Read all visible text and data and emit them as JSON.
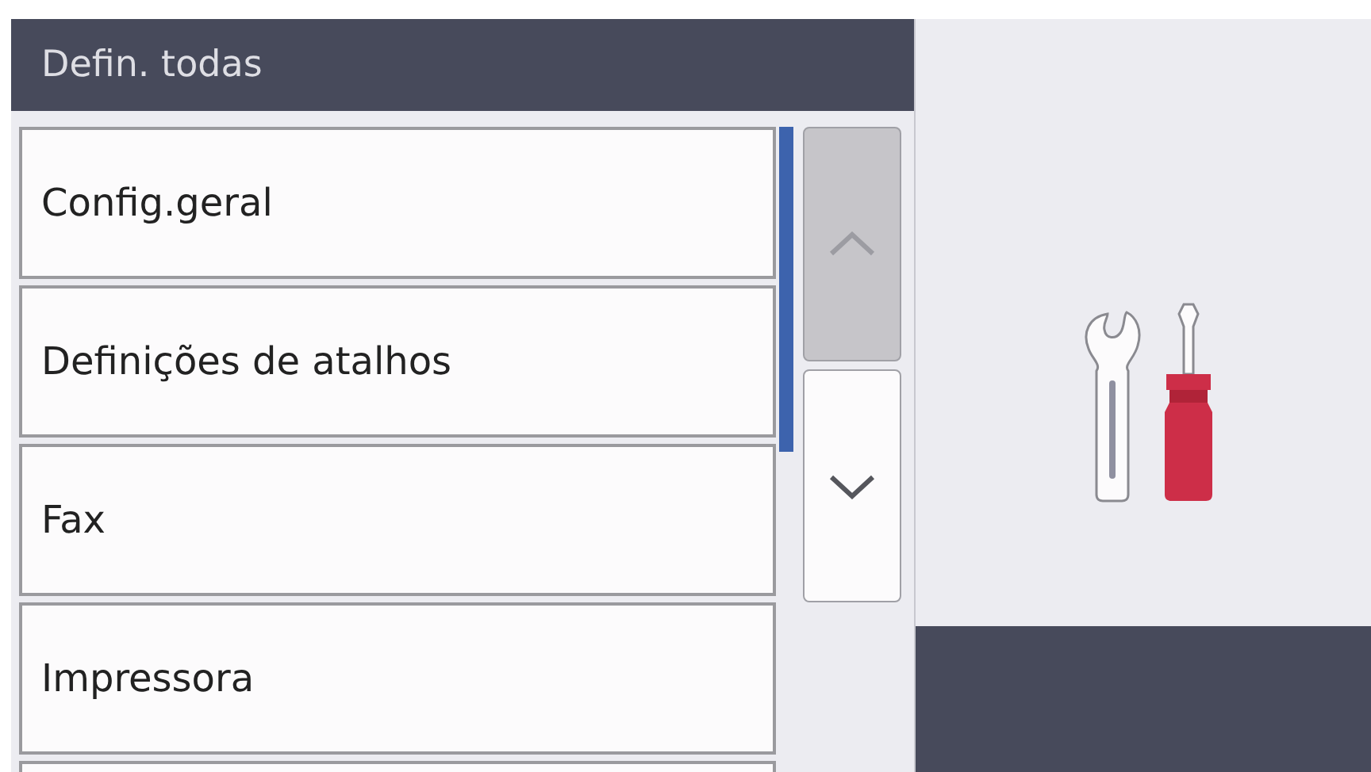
{
  "header": {
    "title": "Defin. todas"
  },
  "menu_items": [
    {
      "label": "Config.geral"
    },
    {
      "label": "Definições de atalhos"
    },
    {
      "label": "Fax"
    },
    {
      "label": "Impressora"
    }
  ],
  "scroll_buttons": {
    "up_disabled": true,
    "down_disabled": false
  }
}
